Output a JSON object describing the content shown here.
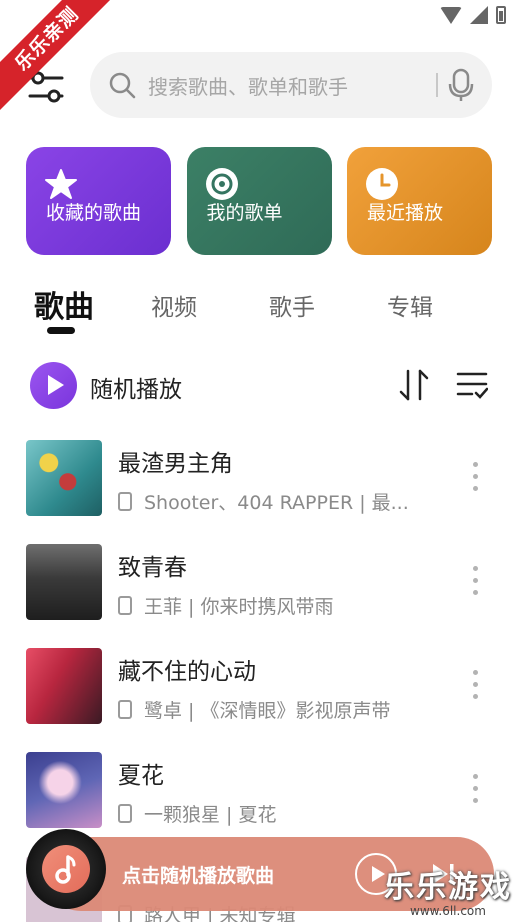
{
  "watermark_ribbon": "乐乐亲测",
  "search": {
    "placeholder": "搜索歌曲、歌单和歌手"
  },
  "cards": [
    {
      "label": "收藏的歌曲",
      "icon": "star-icon",
      "color": "#7b3be0"
    },
    {
      "label": "我的歌单",
      "icon": "music-disc-icon",
      "color": "#357561"
    },
    {
      "label": "最近播放",
      "icon": "clock-icon",
      "color": "#e5952c"
    }
  ],
  "tabs": [
    {
      "label": "歌曲",
      "active": true
    },
    {
      "label": "视频",
      "active": false
    },
    {
      "label": "歌手",
      "active": false
    },
    {
      "label": "专辑",
      "active": false
    }
  ],
  "shuffle": {
    "label": "随机播放"
  },
  "songs": [
    {
      "title": "最渣男主角",
      "meta": "Shooter、404 RAPPER | 最..."
    },
    {
      "title": "致青春",
      "meta": "王菲 | 你来时携风带雨"
    },
    {
      "title": "藏不住的心动",
      "meta": "鹭卓 | 《深情眼》影视原声带"
    },
    {
      "title": "夏花",
      "meta": "一颗狼星 | 夏花"
    },
    {
      "title": "",
      "meta": "路人甲 | 未知专辑"
    }
  ],
  "player": {
    "label": "点击随机播放歌曲"
  },
  "watermark": {
    "title": "乐乐游戏",
    "url": "www.6ll.com"
  },
  "colors": {
    "accent": "#8a44e6",
    "player": "#db8976"
  }
}
